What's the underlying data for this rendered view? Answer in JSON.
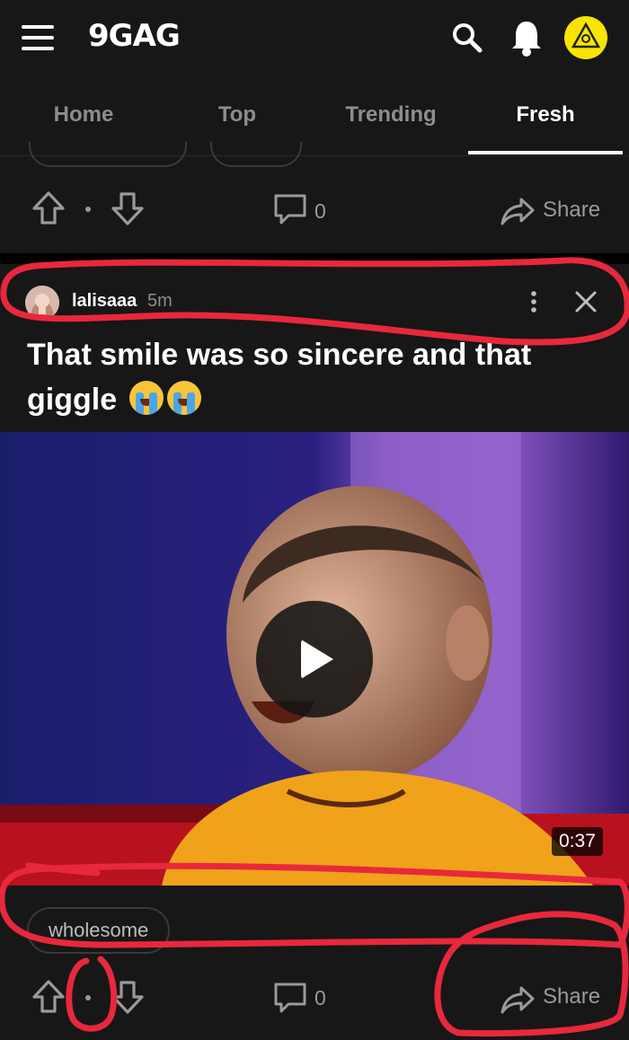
{
  "app": {
    "logo": "9GAG"
  },
  "tabs": [
    {
      "label": "Home"
    },
    {
      "label": "Top"
    },
    {
      "label": "Trending"
    },
    {
      "label": "Fresh",
      "active": true
    }
  ],
  "previous_post": {
    "comment_count": "0",
    "share_label": "Share"
  },
  "post": {
    "username": "lalisaaa",
    "time": "5m",
    "title": "That smile was so sincere and that giggle",
    "title_emojis": [
      "loudly-crying-face",
      "loudly-crying-face"
    ],
    "video": {
      "duration": "0:37"
    },
    "tag": "wholesome",
    "comment_count": "0",
    "share_label": "Share"
  },
  "colors": {
    "background": "#171717",
    "annotation": "#e8283c",
    "avatar_badge": "#f7e500",
    "muted_text": "#9a9a9a"
  }
}
